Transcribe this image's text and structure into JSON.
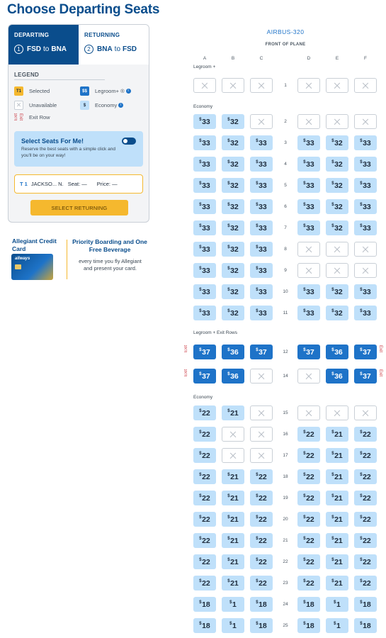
{
  "page": {
    "title": "Choose Departing Seats"
  },
  "tabs": [
    {
      "label": "DEPARTING",
      "num": "1",
      "from": "FSD",
      "to_word": "to",
      "to": "BNA",
      "active": true
    },
    {
      "label": "RETURNING",
      "num": "2",
      "from": "BNA",
      "to_word": "to",
      "to": "FSD",
      "active": false
    }
  ],
  "legend": {
    "title": "LEGEND",
    "selected": {
      "icon_text": "T1",
      "label": "Selected"
    },
    "legroom": {
      "icon_text": "$$",
      "label": "Legroom+ ®"
    },
    "unavailable": {
      "label": "Unavailable"
    },
    "economy": {
      "icon_text": "$",
      "label": "Economy"
    },
    "exit_row": {
      "icon_text": "Exit",
      "label": "Exit Row"
    }
  },
  "select_seats": {
    "title": "Select Seats For Me!",
    "description": "Reserve the best seats with a simple click and you'll be on your way!",
    "toggle_on": true
  },
  "passenger": {
    "tag": "T 1",
    "name": "JACKSO... N.",
    "seat_label": "Seat:",
    "seat_value": "—",
    "price_label": "Price:",
    "price_value": "—"
  },
  "buttons": {
    "select_returning": "SELECT RETURNING"
  },
  "promo": {
    "card_title": "Allegiant Credit Card",
    "card_logo": "allways",
    "headline": "Priority Boarding and One Free Beverage",
    "body": "every time you fly Allegiant and present your card."
  },
  "seat_map": {
    "aircraft": "AIRBUS-320",
    "front_label": "FRONT OF PLANE",
    "columns": [
      "A",
      "B",
      "C",
      "D",
      "E",
      "F"
    ],
    "exit_label": "Exit",
    "sections": [
      {
        "label": "Legroom +",
        "rows": [
          {
            "num": "1",
            "seats": [
              "x",
              "x",
              "x",
              "x",
              "x",
              "x"
            ]
          }
        ]
      },
      {
        "label": "Economy",
        "rows": [
          {
            "num": "2",
            "seats": [
              "e33",
              "e32",
              "x",
              "x",
              "x",
              "x"
            ]
          },
          {
            "num": "3",
            "seats": [
              "e33",
              "e32",
              "e33",
              "e33",
              "e32",
              "e33"
            ]
          },
          {
            "num": "4",
            "seats": [
              "e33",
              "e32",
              "e33",
              "e33",
              "e32",
              "e33"
            ]
          },
          {
            "num": "5",
            "seats": [
              "e33",
              "e32",
              "e33",
              "e33",
              "e32",
              "e33"
            ]
          },
          {
            "num": "6",
            "seats": [
              "e33",
              "e32",
              "e33",
              "e33",
              "e32",
              "e33"
            ]
          },
          {
            "num": "7",
            "seats": [
              "e33",
              "e32",
              "e33",
              "e33",
              "e32",
              "e33"
            ]
          },
          {
            "num": "8",
            "seats": [
              "e33",
              "e32",
              "e33",
              "x",
              "x",
              "x"
            ]
          },
          {
            "num": "9",
            "seats": [
              "e33",
              "e32",
              "e33",
              "x",
              "x",
              "x"
            ]
          },
          {
            "num": "10",
            "seats": [
              "e33",
              "e32",
              "e33",
              "e33",
              "e32",
              "e33"
            ]
          },
          {
            "num": "11",
            "seats": [
              "e33",
              "e32",
              "e33",
              "e33",
              "e32",
              "e33"
            ]
          }
        ]
      },
      {
        "label": "Legroom + Exit Rows",
        "rows": [
          {
            "num": "12",
            "exit": true,
            "seats": [
              "l37",
              "l36",
              "l37",
              "l37",
              "l36",
              "l37"
            ]
          },
          {
            "num": "14",
            "exit": true,
            "seats": [
              "l37",
              "l36",
              "x",
              "x",
              "l36",
              "l37"
            ]
          }
        ]
      },
      {
        "label": "Economy",
        "rows": [
          {
            "num": "15",
            "seats": [
              "e22",
              "e21",
              "x",
              "x",
              "x",
              "x"
            ]
          },
          {
            "num": "16",
            "seats": [
              "e22",
              "x",
              "x",
              "e22",
              "e21",
              "e22"
            ]
          },
          {
            "num": "17",
            "seats": [
              "e22",
              "x",
              "x",
              "e22",
              "e21",
              "e22"
            ]
          },
          {
            "num": "18",
            "seats": [
              "e22",
              "e21",
              "e22",
              "e22",
              "e21",
              "e22"
            ]
          },
          {
            "num": "19",
            "seats": [
              "e22",
              "e21",
              "e22",
              "e22",
              "e21",
              "e22"
            ]
          },
          {
            "num": "20",
            "seats": [
              "e22",
              "e21",
              "e22",
              "e22",
              "e21",
              "e22"
            ]
          },
          {
            "num": "21",
            "seats": [
              "e22",
              "e21",
              "e22",
              "e22",
              "e21",
              "e22"
            ]
          },
          {
            "num": "22",
            "seats": [
              "e22",
              "e21",
              "e22",
              "e22",
              "e21",
              "e22"
            ]
          },
          {
            "num": "23",
            "seats": [
              "e22",
              "e21",
              "e22",
              "e22",
              "e21",
              "e22"
            ]
          },
          {
            "num": "24",
            "seats": [
              "e18",
              "e1",
              "e18",
              "e18",
              "e1",
              "e18"
            ]
          },
          {
            "num": "25",
            "seats": [
              "e18",
              "e1",
              "e18",
              "e18",
              "e1",
              "e18"
            ]
          }
        ]
      }
    ]
  },
  "colors": {
    "brand_blue": "#0a4d8c",
    "legroom_seat": "#1e73c8",
    "economy_seat": "#bfe0fa",
    "accent_gold": "#f5b82e",
    "exit_red": "#c8323c"
  }
}
